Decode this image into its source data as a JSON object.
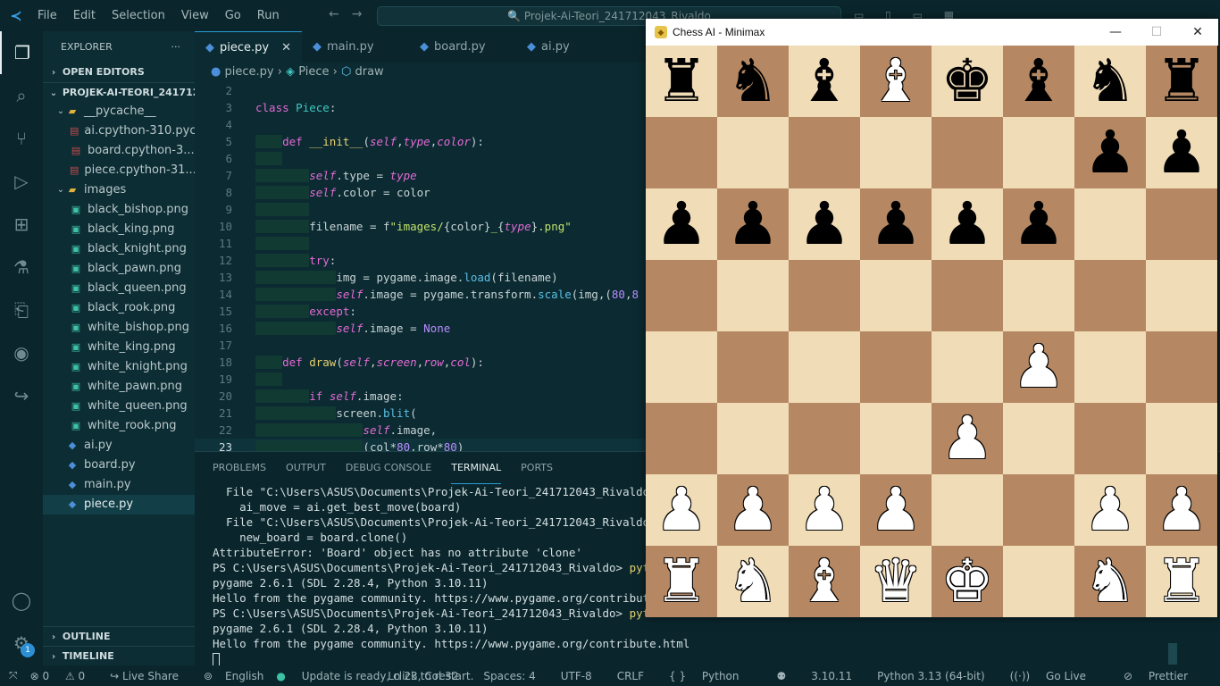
{
  "titlebar": {
    "menu": [
      "File",
      "Edit",
      "Selection",
      "View",
      "Go",
      "Run"
    ],
    "search": "Projek-Ai-Teori_241712043_Rivaldo"
  },
  "sidebar": {
    "title": "EXPLORER",
    "open_editors": "OPEN EDITORS",
    "project": "PROJEK-AI-TEORI_241712...",
    "tree": [
      {
        "label": "__pycache__",
        "type": "folder",
        "depth": 1
      },
      {
        "label": "ai.cpython-310.pyc",
        "type": "pyc",
        "depth": 2
      },
      {
        "label": "board.cpython-3...",
        "type": "pyc",
        "depth": 2
      },
      {
        "label": "piece.cpython-31...",
        "type": "pyc",
        "depth": 2
      },
      {
        "label": "images",
        "type": "folder",
        "depth": 1
      },
      {
        "label": "black_bishop.png",
        "type": "img",
        "depth": 2
      },
      {
        "label": "black_king.png",
        "type": "img",
        "depth": 2
      },
      {
        "label": "black_knight.png",
        "type": "img",
        "depth": 2
      },
      {
        "label": "black_pawn.png",
        "type": "img",
        "depth": 2
      },
      {
        "label": "black_queen.png",
        "type": "img",
        "depth": 2
      },
      {
        "label": "black_rook.png",
        "type": "img",
        "depth": 2
      },
      {
        "label": "white_bishop.png",
        "type": "img",
        "depth": 2
      },
      {
        "label": "white_king.png",
        "type": "img",
        "depth": 2
      },
      {
        "label": "white_knight.png",
        "type": "img",
        "depth": 2
      },
      {
        "label": "white_pawn.png",
        "type": "img",
        "depth": 2
      },
      {
        "label": "white_queen.png",
        "type": "img",
        "depth": 2
      },
      {
        "label": "white_rook.png",
        "type": "img",
        "depth": 2
      },
      {
        "label": "ai.py",
        "type": "py",
        "depth": 1
      },
      {
        "label": "board.py",
        "type": "py",
        "depth": 1
      },
      {
        "label": "main.py",
        "type": "py",
        "depth": 1
      },
      {
        "label": "piece.py",
        "type": "py",
        "depth": 1,
        "selected": true
      }
    ],
    "outline": "OUTLINE",
    "timeline": "TIMELINE"
  },
  "editor": {
    "tabs": [
      "piece.py",
      "main.py",
      "board.py",
      "ai.py"
    ],
    "breadcrumb": {
      "file": "piece.py",
      "cls": "Piece",
      "method": "draw"
    },
    "current_line": "23"
  },
  "panel": {
    "tabs": [
      "PROBLEMS",
      "OUTPUT",
      "DEBUG CONSOLE",
      "TERMINAL",
      "PORTS"
    ],
    "active_tab": "TERMINAL",
    "lines": [
      "  File \"C:\\Users\\ASUS\\Documents\\Projek-Ai-Teori_241712043_Rivaldo\\mai",
      "    ai_move = ai.get_best_move(board)",
      "  File \"C:\\Users\\ASUS\\Documents\\Projek-Ai-Teori_241712043_Rivaldo\\ai.",
      "    new_board = board.clone()",
      "AttributeError: 'Board' object has no attribute 'clone'",
      "PS C:\\Users\\ASUS\\Documents\\Projek-Ai-Teori_241712043_Rivaldo> ",
      "pygame 2.6.1 (SDL 2.28.4, Python 3.10.11)",
      "Hello from the pygame community. https://www.pygame.org/contribute.html",
      "PS C:\\Users\\ASUS\\Documents\\Projek-Ai-Teori_241712043_Rivaldo> ",
      "pygame 2.6.1 (SDL 2.28.4, Python 3.10.11)",
      "Hello from the pygame community. https://www.pygame.org/contribute.html"
    ],
    "cmd": "python m"
  },
  "statusbar": {
    "errors": "0",
    "warnings": "0",
    "live_share": "Live Share",
    "language_pack": "English",
    "update": "Update is ready, click to restart.",
    "position": "Ln 23, Col 32",
    "spaces": "Spaces: 4",
    "encoding": "UTF-8",
    "eol": "CRLF",
    "lang": "Python",
    "pyver": "3.10.11",
    "interp": "Python 3.13 (64-bit)",
    "golive": "Go Live",
    "prettier": "Prettier"
  },
  "chess": {
    "title": "Chess AI - Minimax",
    "board": [
      [
        "br",
        "bn",
        "bb",
        "wb",
        "bk",
        "bb",
        "bn",
        "br"
      ],
      [
        "",
        "",
        "",
        "",
        "",
        "",
        "bp",
        "bp"
      ],
      [
        "bp",
        "bp",
        "bp",
        "bp",
        "bp",
        "bp",
        "",
        ""
      ],
      [
        "",
        "",
        "",
        "",
        "",
        "",
        "",
        ""
      ],
      [
        "",
        "",
        "",
        "",
        "",
        "wp",
        "",
        ""
      ],
      [
        "",
        "",
        "",
        "",
        "wp",
        "",
        "",
        ""
      ],
      [
        "wp",
        "wp",
        "wp",
        "wp",
        "",
        "",
        "wp",
        "wp"
      ],
      [
        "wr",
        "wn",
        "wb",
        "wq",
        "wk",
        "",
        "wn",
        "wr"
      ]
    ]
  },
  "badge": "1"
}
